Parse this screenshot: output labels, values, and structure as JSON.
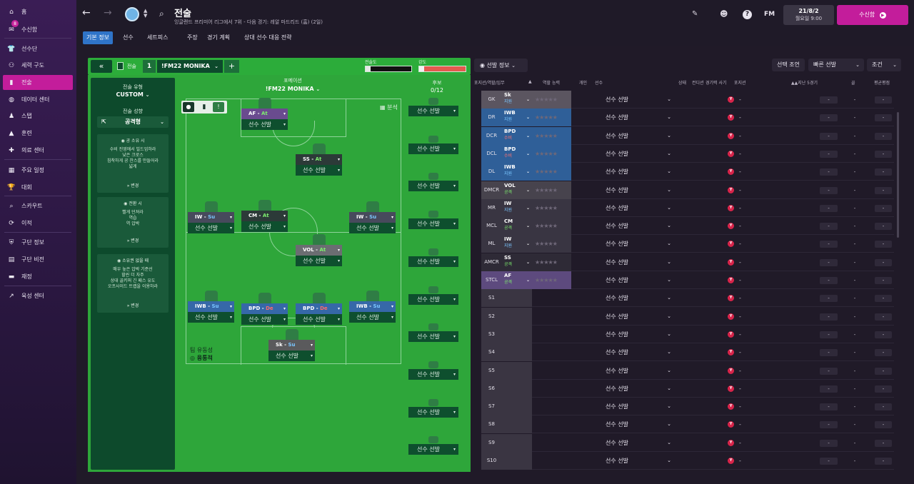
{
  "sidebar": {
    "items": [
      {
        "label": "홈",
        "icon": "home-icon",
        "glyph": "⌂"
      },
      {
        "label": "수신함",
        "icon": "inbox-icon",
        "glyph": "✉",
        "badge": "8"
      },
      {
        "label": "선수단",
        "icon": "shirt-icon",
        "glyph": "👕"
      },
      {
        "label": "세력 구도",
        "icon": "dynamics-icon",
        "glyph": "⚇"
      },
      {
        "label": "전술",
        "icon": "tactics-icon",
        "glyph": "▮"
      },
      {
        "label": "데이터 센터",
        "icon": "data-hub-icon",
        "glyph": "◍"
      },
      {
        "label": "스탭",
        "icon": "staff-icon",
        "glyph": "♟"
      },
      {
        "label": "훈련",
        "icon": "training-icon",
        "glyph": "▲"
      },
      {
        "label": "의료 센터",
        "icon": "medical-icon",
        "glyph": "✚"
      },
      {
        "label": "주요 일정",
        "icon": "calendar-icon",
        "glyph": "▦"
      },
      {
        "label": "대회",
        "icon": "trophy-icon",
        "glyph": "🏆"
      },
      {
        "label": "스카우트",
        "icon": "scouting-icon",
        "glyph": "⌕"
      },
      {
        "label": "이적",
        "icon": "transfers-icon",
        "glyph": "⟳"
      },
      {
        "label": "구단 정보",
        "icon": "club-info-icon",
        "glyph": "⛨"
      },
      {
        "label": "구단 비전",
        "icon": "club-vision-icon",
        "glyph": "▤"
      },
      {
        "label": "재정",
        "icon": "finances-icon",
        "glyph": "▬"
      },
      {
        "label": "육성 센터",
        "icon": "development-icon",
        "glyph": "↗"
      }
    ]
  },
  "header": {
    "title": "전술",
    "subtitle": "잉글랜드 프리미어 리그에서 7위 - 다음 경기: 레알 마드리드 (홈) (2일)",
    "date_line1": "21/8/2",
    "date_line2": "월요일 9:00",
    "continue_label": "수신함",
    "fm_label": "FM"
  },
  "subnav": [
    "기본 정보",
    "선수",
    "세트피스",
    "주장",
    "경기 계획",
    "상대 선수 대응 전략"
  ],
  "tactic_bar": {
    "tactic_label": "전술",
    "slot_number": "1",
    "tactic_name": "!FM22 MONIKA",
    "add": "+",
    "familiarity_label": "전술도",
    "intensity_label": "강도"
  },
  "instructions": {
    "style_label": "전술 유형",
    "style_value": "CUSTOM",
    "mentality_label": "전술 성향",
    "mentality_value": "공격형",
    "in_possession": {
      "title": "공 소유 시",
      "body": [
        "수비 진영에서 빌드업하라",
        "낮은 크로스",
        "침착하게 공 찬스를 만들어라",
        "넓게"
      ],
      "change": "변경"
    },
    "transition": {
      "title": "전환 시",
      "body": [
        "빨게 던져라",
        "역습",
        "역 압박"
      ],
      "change": "변경"
    },
    "out_of_possession": {
      "title": "소유권 없을 때",
      "body": [
        "매우 높은 압박 기준선",
        "할씬 더 자주",
        "상대 골키퍼 긴 패스 유도",
        "오프사이드 트랩을 이용하라"
      ],
      "change": "변경"
    }
  },
  "pitch": {
    "formation_label": "포메이션",
    "formation_value": "!FM22 MONIKA",
    "analysis_label": "분석",
    "fluidity_label": "팀 유동성",
    "fluidity_value": "융통적",
    "select_label": "선수 선발",
    "positions": [
      {
        "role": "AF",
        "duty": "At",
        "duty_class": "role-at",
        "bg": "#6a4b8f"
      },
      {
        "role": "SS",
        "duty": "At",
        "duty_class": "role-at",
        "bg": "#2c3a38"
      },
      {
        "role": "IW",
        "duty": "Su",
        "duty_class": "role-su",
        "bg": "#474a5c"
      },
      {
        "role": "CM",
        "duty": "At",
        "duty_class": "role-at",
        "bg": "#2c3a38"
      },
      {
        "role": "IW",
        "duty": "Su",
        "duty_class": "role-su",
        "bg": "#474a5c"
      },
      {
        "role": "VOL",
        "duty": "At",
        "duty_class": "role-at",
        "bg": "#6b6d72"
      },
      {
        "role": "IWB",
        "duty": "Su",
        "duty_class": "role-su",
        "bg": "#3668a8"
      },
      {
        "role": "BPD",
        "duty": "De",
        "duty_class": "role-de",
        "bg": "#3668a8"
      },
      {
        "role": "BPD",
        "duty": "De",
        "duty_class": "role-de",
        "bg": "#3668a8"
      },
      {
        "role": "IWB",
        "duty": "Su",
        "duty_class": "role-su",
        "bg": "#3668a8"
      },
      {
        "role": "Sk",
        "duty": "Su",
        "duty_class": "role-su",
        "bg": "#5a5a5c"
      }
    ]
  },
  "subs": {
    "label": "후보",
    "count": "0/12",
    "select_label": "선수 선발"
  },
  "right_panel": {
    "tab_label": "선발 정보",
    "btn_select": "선택 조언",
    "btn_quick": "빠른 선발",
    "btn_filter": "조건",
    "headers": [
      "포지션/역할/임무",
      "역할 능력",
      "개인",
      "선수",
      "상태",
      "컨디션",
      "경기력 사기",
      "포지션",
      "지난 5경기",
      "골",
      "평균평점"
    ],
    "rows": [
      {
        "pos": "GK",
        "role": "Sk",
        "duty": "지원",
        "duty_color": "#7ac6ff",
        "role_bg": "#5b5560",
        "pos_bg": "#5b5560"
      },
      {
        "pos": "DR",
        "role": "IWB",
        "duty": "지원",
        "duty_color": "#7ac6ff",
        "role_bg": "#2f5f98",
        "pos_bg": "#2f5f98"
      },
      {
        "pos": "DCR",
        "role": "BPD",
        "duty": "수비",
        "duty_color": "#ff7070",
        "role_bg": "#2f5f98",
        "pos_bg": "#2f5f98"
      },
      {
        "pos": "DCL",
        "role": "BPD",
        "duty": "수비",
        "duty_color": "#ff7070",
        "role_bg": "#2f5f98",
        "pos_bg": "#2f5f98"
      },
      {
        "pos": "DL",
        "role": "IWB",
        "duty": "지원",
        "duty_color": "#7ac6ff",
        "role_bg": "#2f5f98",
        "pos_bg": "#2f5f98"
      },
      {
        "pos": "DMCR",
        "role": "VOL",
        "duty": "공격",
        "duty_color": "#7eef6f",
        "role_bg": "#47434d",
        "pos_bg": "#47434d"
      },
      {
        "pos": "MR",
        "role": "IW",
        "duty": "지원",
        "duty_color": "#7ac6ff",
        "role_bg": "#393542",
        "pos_bg": "#393542"
      },
      {
        "pos": "MCL",
        "role": "CM",
        "duty": "공격",
        "duty_color": "#7eef6f",
        "role_bg": "#393542",
        "pos_bg": "#393542"
      },
      {
        "pos": "ML",
        "role": "IW",
        "duty": "지원",
        "duty_color": "#7ac6ff",
        "role_bg": "#393542",
        "pos_bg": "#393542"
      },
      {
        "pos": "AMCR",
        "role": "SS",
        "duty": "공격",
        "duty_color": "#7eef6f",
        "role_bg": "#2e2a36",
        "pos_bg": "#2e2a36"
      },
      {
        "pos": "STCL",
        "role": "AF",
        "duty": "공격",
        "duty_color": "#7eef6f",
        "role_bg": "#5d4a7e",
        "pos_bg": "#5d4a7e"
      },
      {
        "pos": "S1"
      },
      {
        "pos": "S2"
      },
      {
        "pos": "S3"
      },
      {
        "pos": "S4"
      },
      {
        "pos": "S5"
      },
      {
        "pos": "S6"
      },
      {
        "pos": "S7"
      },
      {
        "pos": "S8"
      },
      {
        "pos": "S9"
      },
      {
        "pos": "S10"
      }
    ],
    "select_label": "선수 선발",
    "stars": "★★★★★",
    "dash": "-",
    "condition_badge": "Y"
  }
}
